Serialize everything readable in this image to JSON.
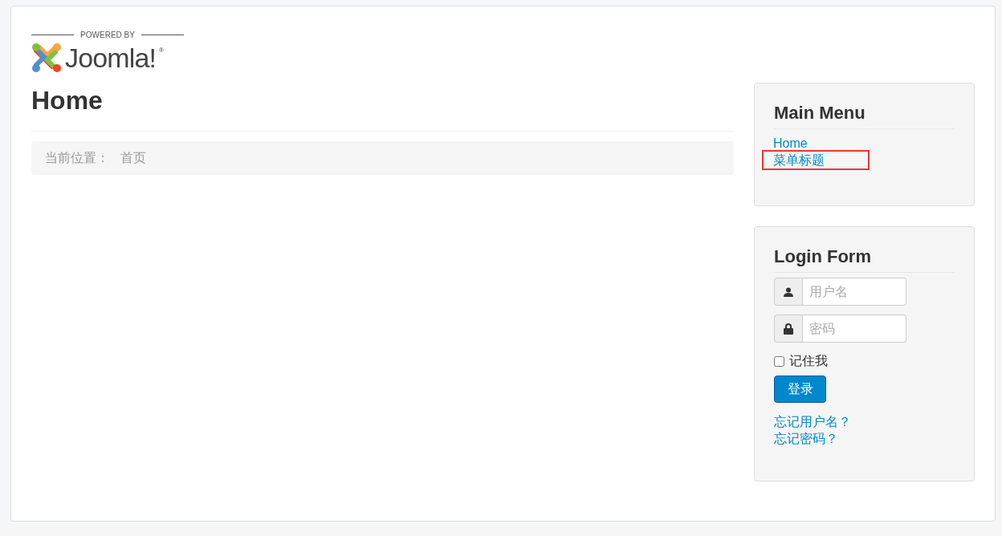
{
  "header": {
    "powered_by": "POWERED BY",
    "logo_text": "Joomla!",
    "logo_mark": "®"
  },
  "page": {
    "title": "Home",
    "breadcrumb": {
      "label": "当前位置：",
      "current": "首页"
    }
  },
  "main_menu": {
    "title": "Main Menu",
    "items": [
      {
        "label": "Home",
        "highlighted": false
      },
      {
        "label": "菜单标题",
        "highlighted": true
      }
    ]
  },
  "login_form": {
    "title": "Login Form",
    "username": {
      "placeholder": "用户名"
    },
    "password": {
      "placeholder": "密码"
    },
    "remember": {
      "label": "记住我",
      "checked": false
    },
    "submit": "登录",
    "links": [
      "忘记用户名？",
      "忘记密码？"
    ]
  }
}
